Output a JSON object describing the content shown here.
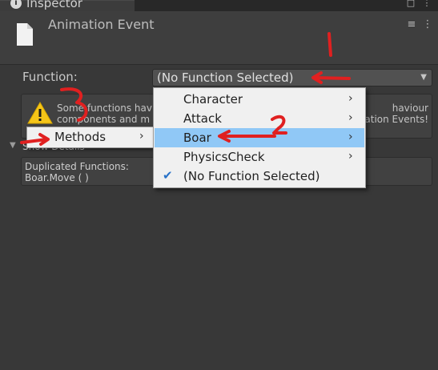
{
  "tab": {
    "title": "Inspector"
  },
  "header": {
    "title": "Animation Event"
  },
  "function_row": {
    "label": "Function:",
    "value": "(No Function Selected)"
  },
  "warning": {
    "text": "Some functions hav… behaviour components and m… Animation Events!",
    "line1_left": "Some functions hav",
    "line1_right": "haviour",
    "line2_left": "components and m",
    "line2_right": "ation Events!"
  },
  "foldout": {
    "label": "Show Details"
  },
  "duplicated": {
    "line1": "Duplicated Functions:",
    "line2": "Boar.Move ( )"
  },
  "methods_menu": {
    "label": "Methods"
  },
  "function_menu": {
    "items": [
      {
        "label": "Character"
      },
      {
        "label": "Attack"
      },
      {
        "label": "Boar"
      },
      {
        "label": "PhysicsCheck"
      },
      {
        "label": "(No Function Selected)"
      }
    ]
  },
  "annotations": {
    "mark_1": "1",
    "mark_2": "2",
    "mark_3": "3",
    "color": "#e02020"
  },
  "colors": {
    "highlight": "#90c8f6",
    "menu_bg": "#f0f0f0",
    "panel_bg": "#383838"
  }
}
